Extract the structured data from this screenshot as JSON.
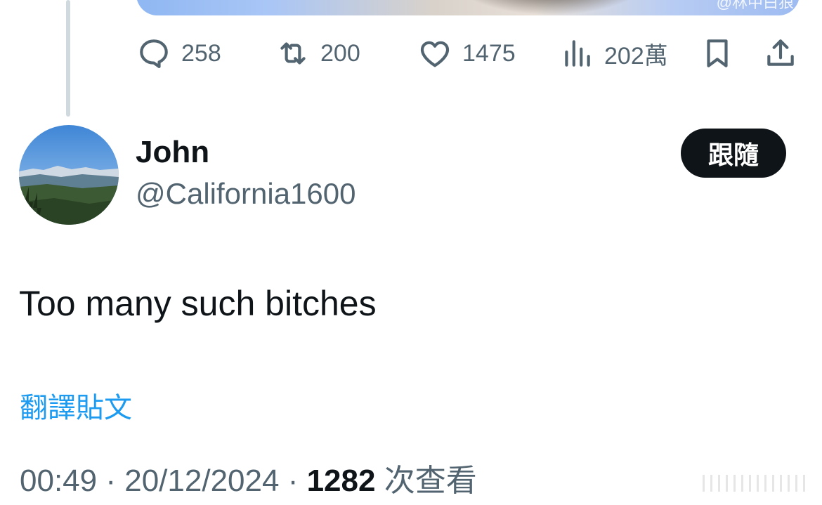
{
  "media": {
    "watermark": "@林中白狼"
  },
  "actions": {
    "reply_count": "258",
    "retweet_count": "200",
    "like_count": "1475",
    "views_count": "202萬"
  },
  "author": {
    "display_name": "John",
    "handle": "@California1600",
    "follow_label": "跟隨"
  },
  "tweet": {
    "text": "Too many such bitches",
    "translate_label": "翻譯貼文",
    "time": "00:49",
    "date": "20/12/2024",
    "views": "1282",
    "views_suffix": "次查看",
    "separator": "·"
  },
  "icons": {
    "reply": "reply-icon",
    "retweet": "retweet-icon",
    "like": "heart-icon",
    "views": "views-chart-icon",
    "bookmark": "bookmark-icon",
    "share": "share-icon"
  },
  "colors": {
    "accent": "#1d9bf0",
    "text_primary": "#0f1419",
    "text_secondary": "#536471",
    "follow_bg": "#0f1419"
  }
}
